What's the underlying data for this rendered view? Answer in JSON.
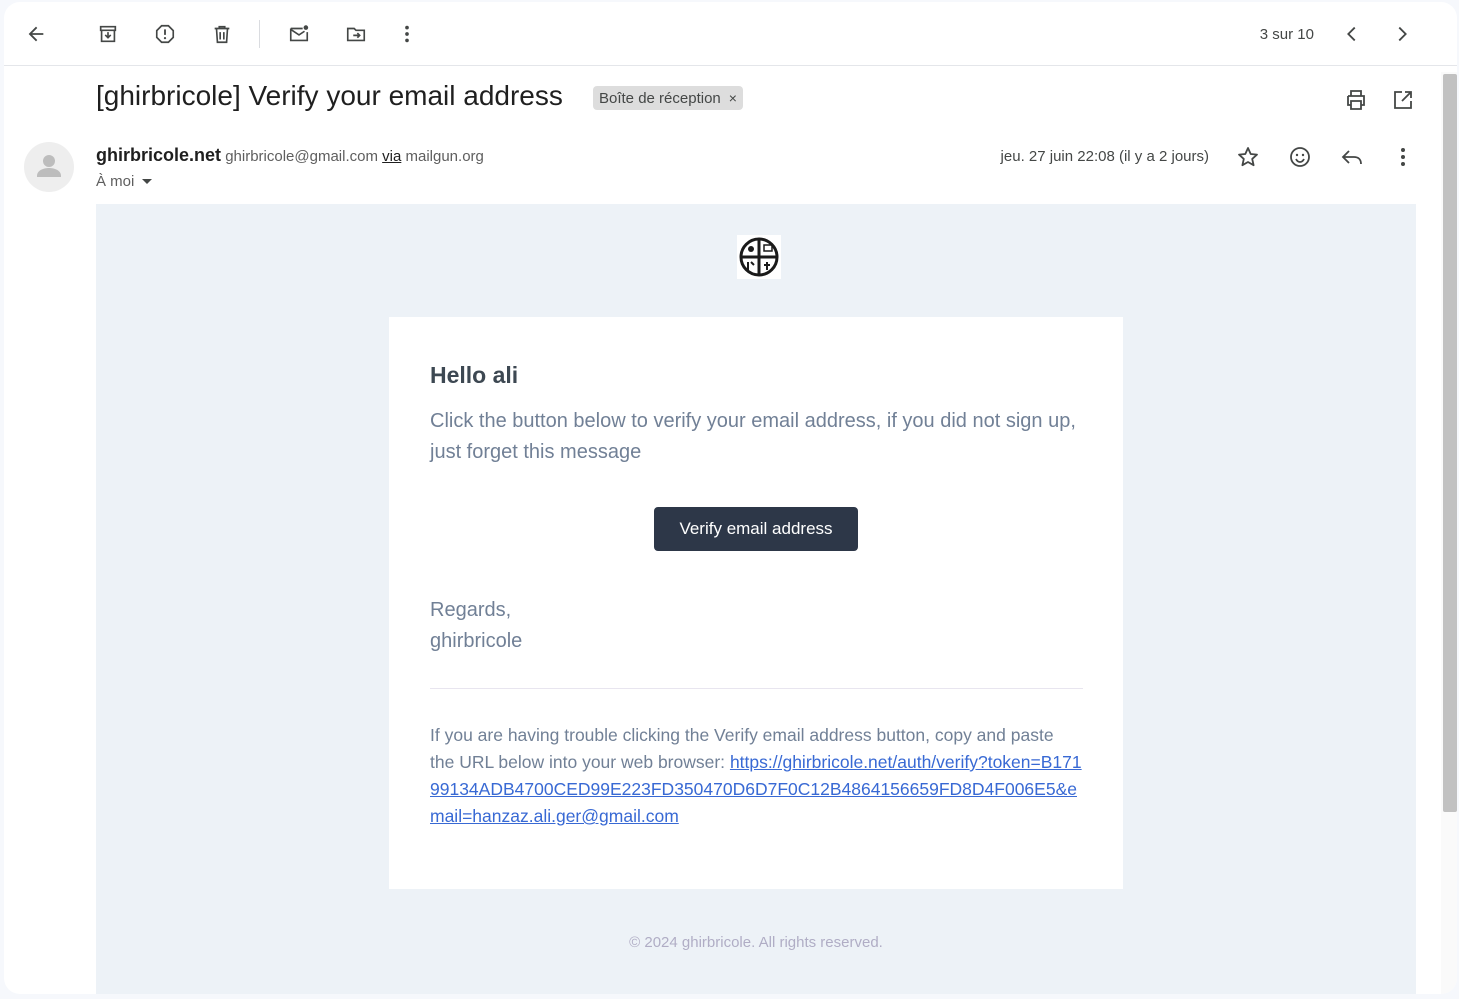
{
  "toolbar": {
    "back_icon": "arrow-left-icon",
    "archive_icon": "archive-icon",
    "report_spam_icon": "report-spam-icon",
    "delete_icon": "trash-icon",
    "mark_unread_icon": "mark-unread-icon",
    "move_to_icon": "move-to-folder-icon",
    "more_icon": "more-vert-icon",
    "pager": "3 sur 10",
    "prev_icon": "chevron-left-icon",
    "next_icon": "chevron-right-icon"
  },
  "email": {
    "subject": "[ghirbricole] Verify your email address",
    "label": "Boîte de réception",
    "label_close": "×",
    "sender_name": "ghirbricole.net",
    "sender_email": "ghirbricole@gmail.com",
    "via_label": "via",
    "via_domain": "mailgun.org",
    "to_line": "À moi",
    "date": "jeu. 27 juin 22:08 (il y a 2 jours)"
  },
  "body": {
    "greeting": "Hello ali",
    "intro": "Click the button below to verify your email address, if you did not sign up, just forget this message",
    "button_label": "Verify email address",
    "regards": "Regards,",
    "signature": "ghirbricole",
    "trouble_text": "If you are having trouble clicking the Verify email address button, copy and paste the URL below into your web browser:",
    "verify_url": "https://ghirbricole.net/auth/verify?token=B17199134ADB4700CED99E223FD350470D6D7F0C12B4864156659FD8D4F006E5&email=hanzaz.ali.ger@gmail.com",
    "footer": "© 2024 ghirbricole. All rights reserved."
  },
  "colors": {
    "button_bg": "#2d3748",
    "email_bg": "#edf2f7",
    "link": "#3869d4"
  }
}
